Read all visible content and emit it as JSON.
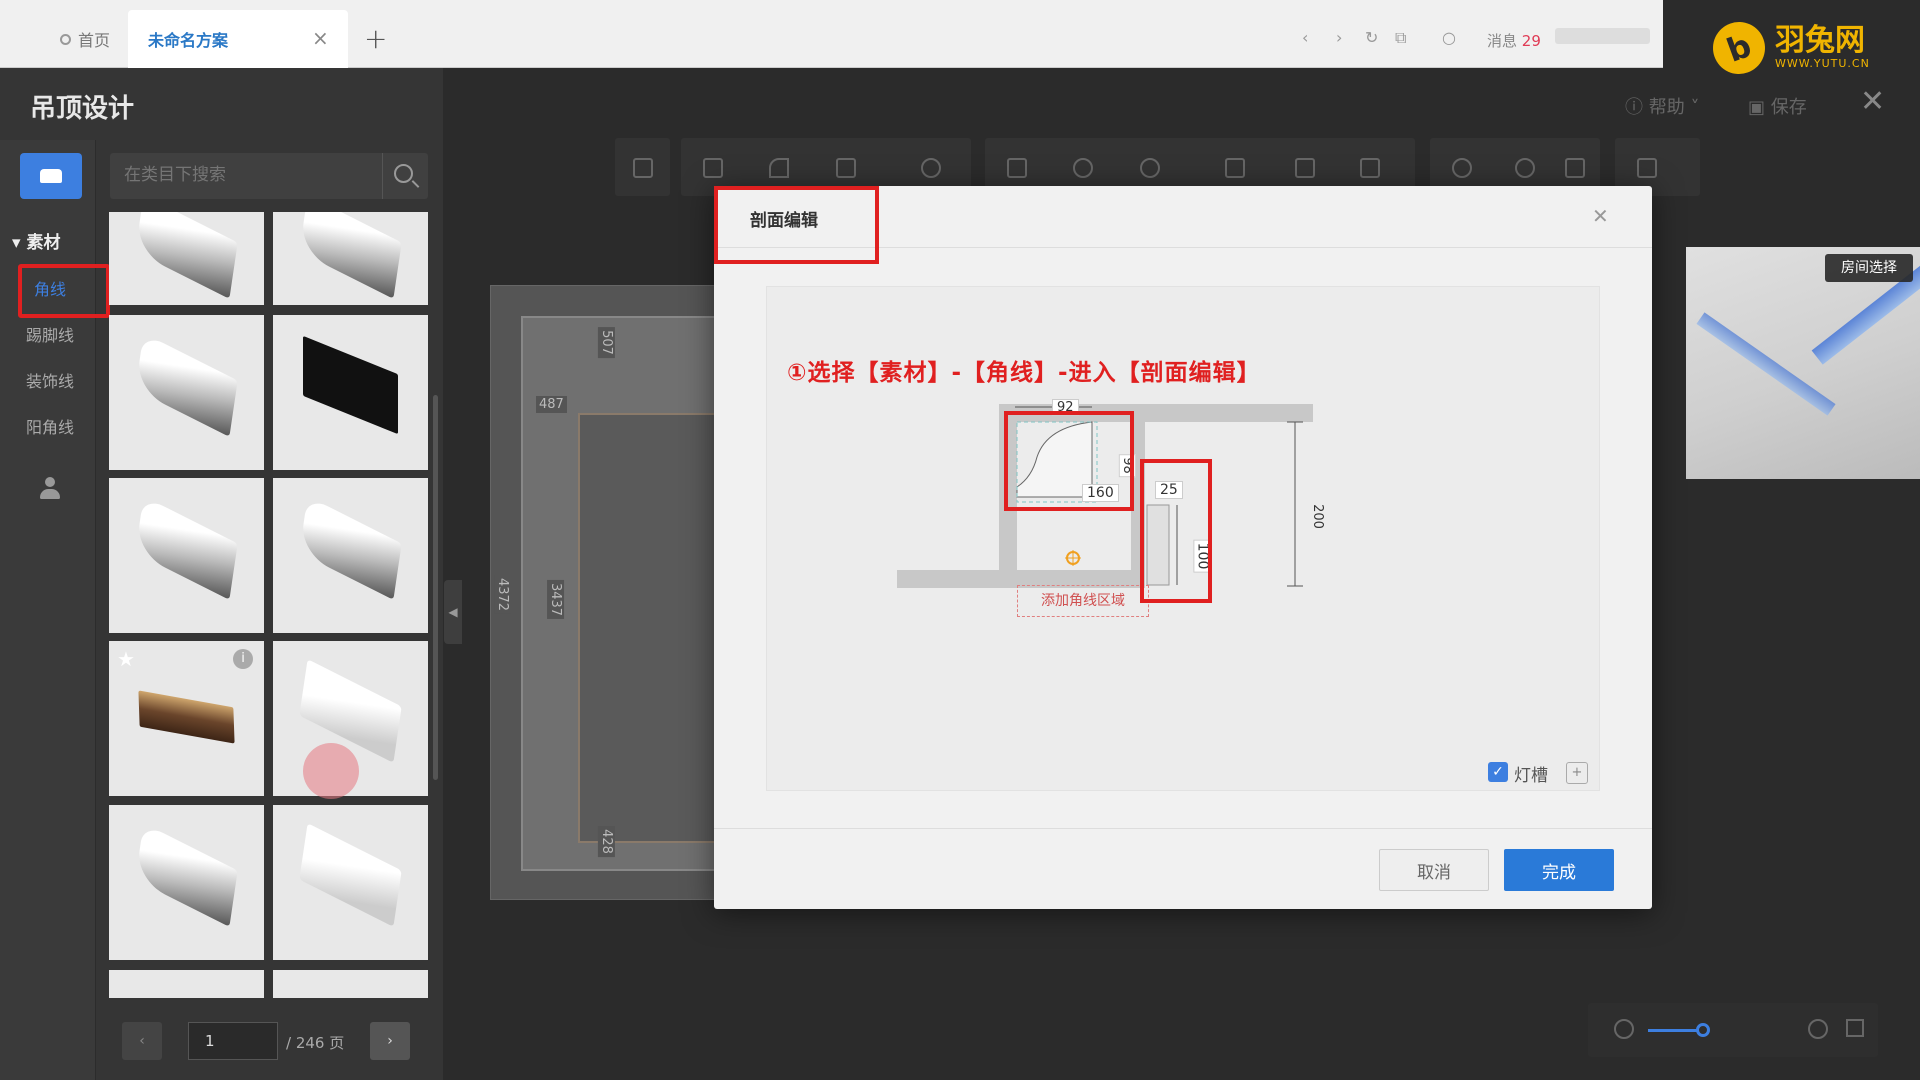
{
  "browser": {
    "home_tab": "首页",
    "active_tab": "未命名方案",
    "messages_label": "消息",
    "messages_count": "29"
  },
  "logo": {
    "name": "羽兔网",
    "url_text": "WWW.YUTU.CN"
  },
  "app": {
    "title": "吊顶设计",
    "help": "帮助",
    "save": "保存"
  },
  "sidebar": {
    "section": "素材",
    "categories": [
      "角线",
      "踢脚线",
      "装饰线",
      "阳角线"
    ],
    "selected": "角线"
  },
  "search": {
    "placeholder": "在类目下搜索"
  },
  "pager": {
    "current": "1",
    "total_text": "/ 246 页"
  },
  "canvas": {
    "dims": [
      "487",
      "507",
      "4372",
      "3437",
      "428"
    ]
  },
  "preview": {
    "room_select": "房间选择"
  },
  "modal": {
    "title": "剖面编辑",
    "instruction": "①选择【素材】-【角线】-进入【剖面编辑】",
    "dims": {
      "width_92": "92",
      "height_98": "98",
      "length_160": "160",
      "width_25": "25",
      "height_100": "100",
      "height_200": "200"
    },
    "add_zone": "添加角线区域",
    "light_slot": "灯槽",
    "cancel": "取消",
    "done": "完成"
  },
  "colors": {
    "accent": "#2a7ad8",
    "highlight": "#e02020",
    "logo": "#f0b400"
  }
}
